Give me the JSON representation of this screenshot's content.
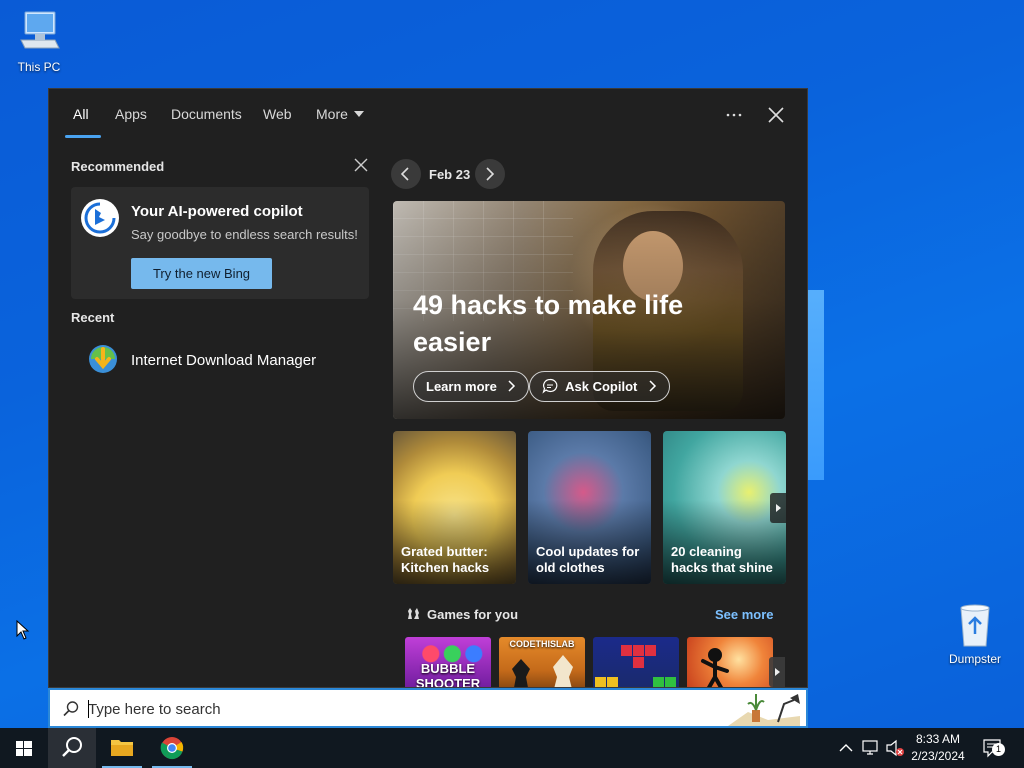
{
  "desktop": {
    "this_pc_label": "This PC",
    "dumpster_label": "Dumpster"
  },
  "tabs": [
    {
      "label": "All",
      "active": true
    },
    {
      "label": "Apps"
    },
    {
      "label": "Documents"
    },
    {
      "label": "Web"
    },
    {
      "label": "More"
    }
  ],
  "left": {
    "recommended_title": "Recommended",
    "copilot_card": {
      "title": "Your AI-powered copilot",
      "subtitle": "Say goodbye to endless search results!",
      "button": "Try the new Bing"
    },
    "recent_title": "Recent",
    "recent_items": [
      {
        "label": "Internet Download Manager",
        "icon": "idm-icon"
      }
    ]
  },
  "right": {
    "date": "Feb 23",
    "hero": {
      "title": "49 hacks to make life easier",
      "learn_more": "Learn more",
      "ask_copilot": "Ask Copilot"
    },
    "cards": [
      {
        "title": "Grated butter: Kitchen hacks"
      },
      {
        "title": "Cool updates for old clothes"
      },
      {
        "title": "20 cleaning hacks that shine"
      }
    ],
    "games_title": "Games for you",
    "see_more": "See more",
    "games": [
      {
        "label": "BUBBLE SHOOTER"
      },
      {
        "label": "CODETHISLAB"
      },
      {
        "label": ""
      },
      {
        "label": ""
      }
    ]
  },
  "search": {
    "placeholder": "Type here to search"
  },
  "taskbar": {
    "time": "8:33 AM",
    "date": "2/23/2024",
    "notification_count": "1"
  },
  "colors": {
    "accent": "#4aa3f0",
    "button_blue": "#76b9ed",
    "panel_bg": "#202020",
    "desktop_blue": "#0a63dc",
    "link": "#7cc0ff"
  }
}
